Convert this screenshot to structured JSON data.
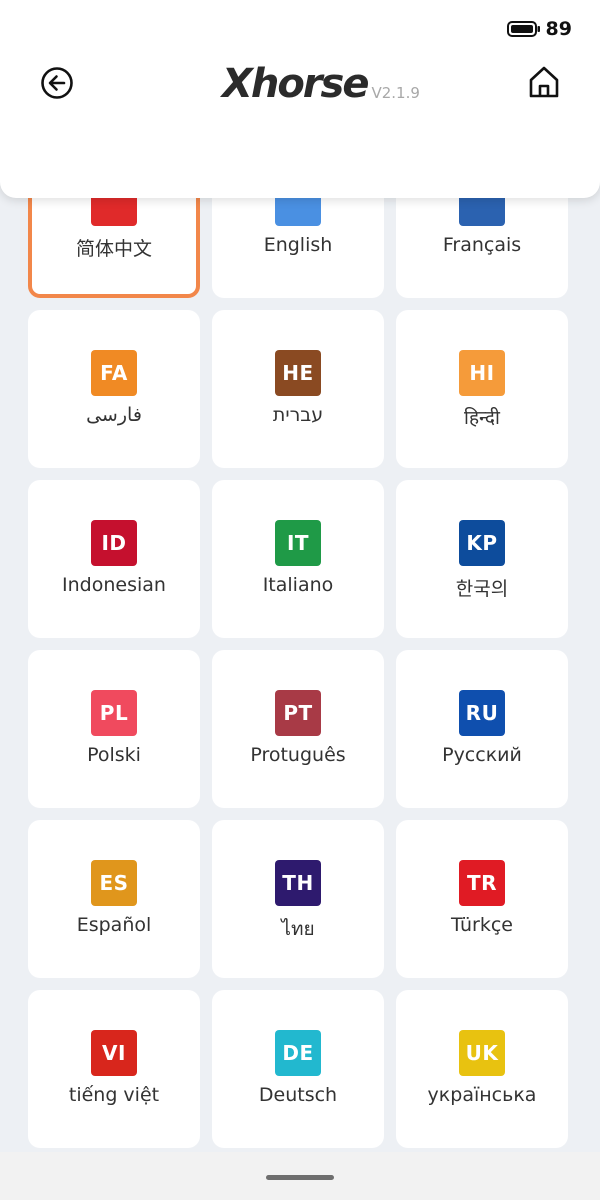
{
  "status_bar": {
    "battery_level": "89"
  },
  "header": {
    "logo_text": "Xhorse",
    "version": "V2.1.9",
    "back_icon": "back-arrow-circle-icon",
    "home_icon": "home-icon"
  },
  "languages": [
    {
      "code": "",
      "label": "简体中文",
      "color": "#e02a2a",
      "selected": true
    },
    {
      "code": "",
      "label": "English",
      "color": "#4a90e2"
    },
    {
      "code": "",
      "label": "Français",
      "color": "#2b62b0"
    },
    {
      "code": "FA",
      "label": "فارسی",
      "color": "#f08a24"
    },
    {
      "code": "HE",
      "label": "עברית",
      "color": "#8a4a22"
    },
    {
      "code": "HI",
      "label": "हिन्दी",
      "color": "#f59b3a"
    },
    {
      "code": "ID",
      "label": "Indonesian",
      "color": "#c5102e"
    },
    {
      "code": "IT",
      "label": "Italiano",
      "color": "#1f9a47"
    },
    {
      "code": "KP",
      "label": "한국의",
      "color": "#0d4c9c"
    },
    {
      "code": "PL",
      "label": "Polski",
      "color": "#f04a5e"
    },
    {
      "code": "PT",
      "label": "Protuguês",
      "color": "#a83a46"
    },
    {
      "code": "RU",
      "label": "Русский",
      "color": "#0f4fae"
    },
    {
      "code": "ES",
      "label": "Español",
      "color": "#e0961c"
    },
    {
      "code": "TH",
      "label": "ไทย",
      "color": "#2e1a6e"
    },
    {
      "code": "TR",
      "label": "Türkçe",
      "color": "#e01b24"
    },
    {
      "code": "VI",
      "label": "tiếng việt",
      "color": "#d8261c"
    },
    {
      "code": "DE",
      "label": "Deutsch",
      "color": "#22b8cf"
    },
    {
      "code": "UK",
      "label": "українська",
      "color": "#e8c210"
    }
  ],
  "colors": {
    "selected_border": "#f2874a",
    "background": "#edf0f4"
  }
}
